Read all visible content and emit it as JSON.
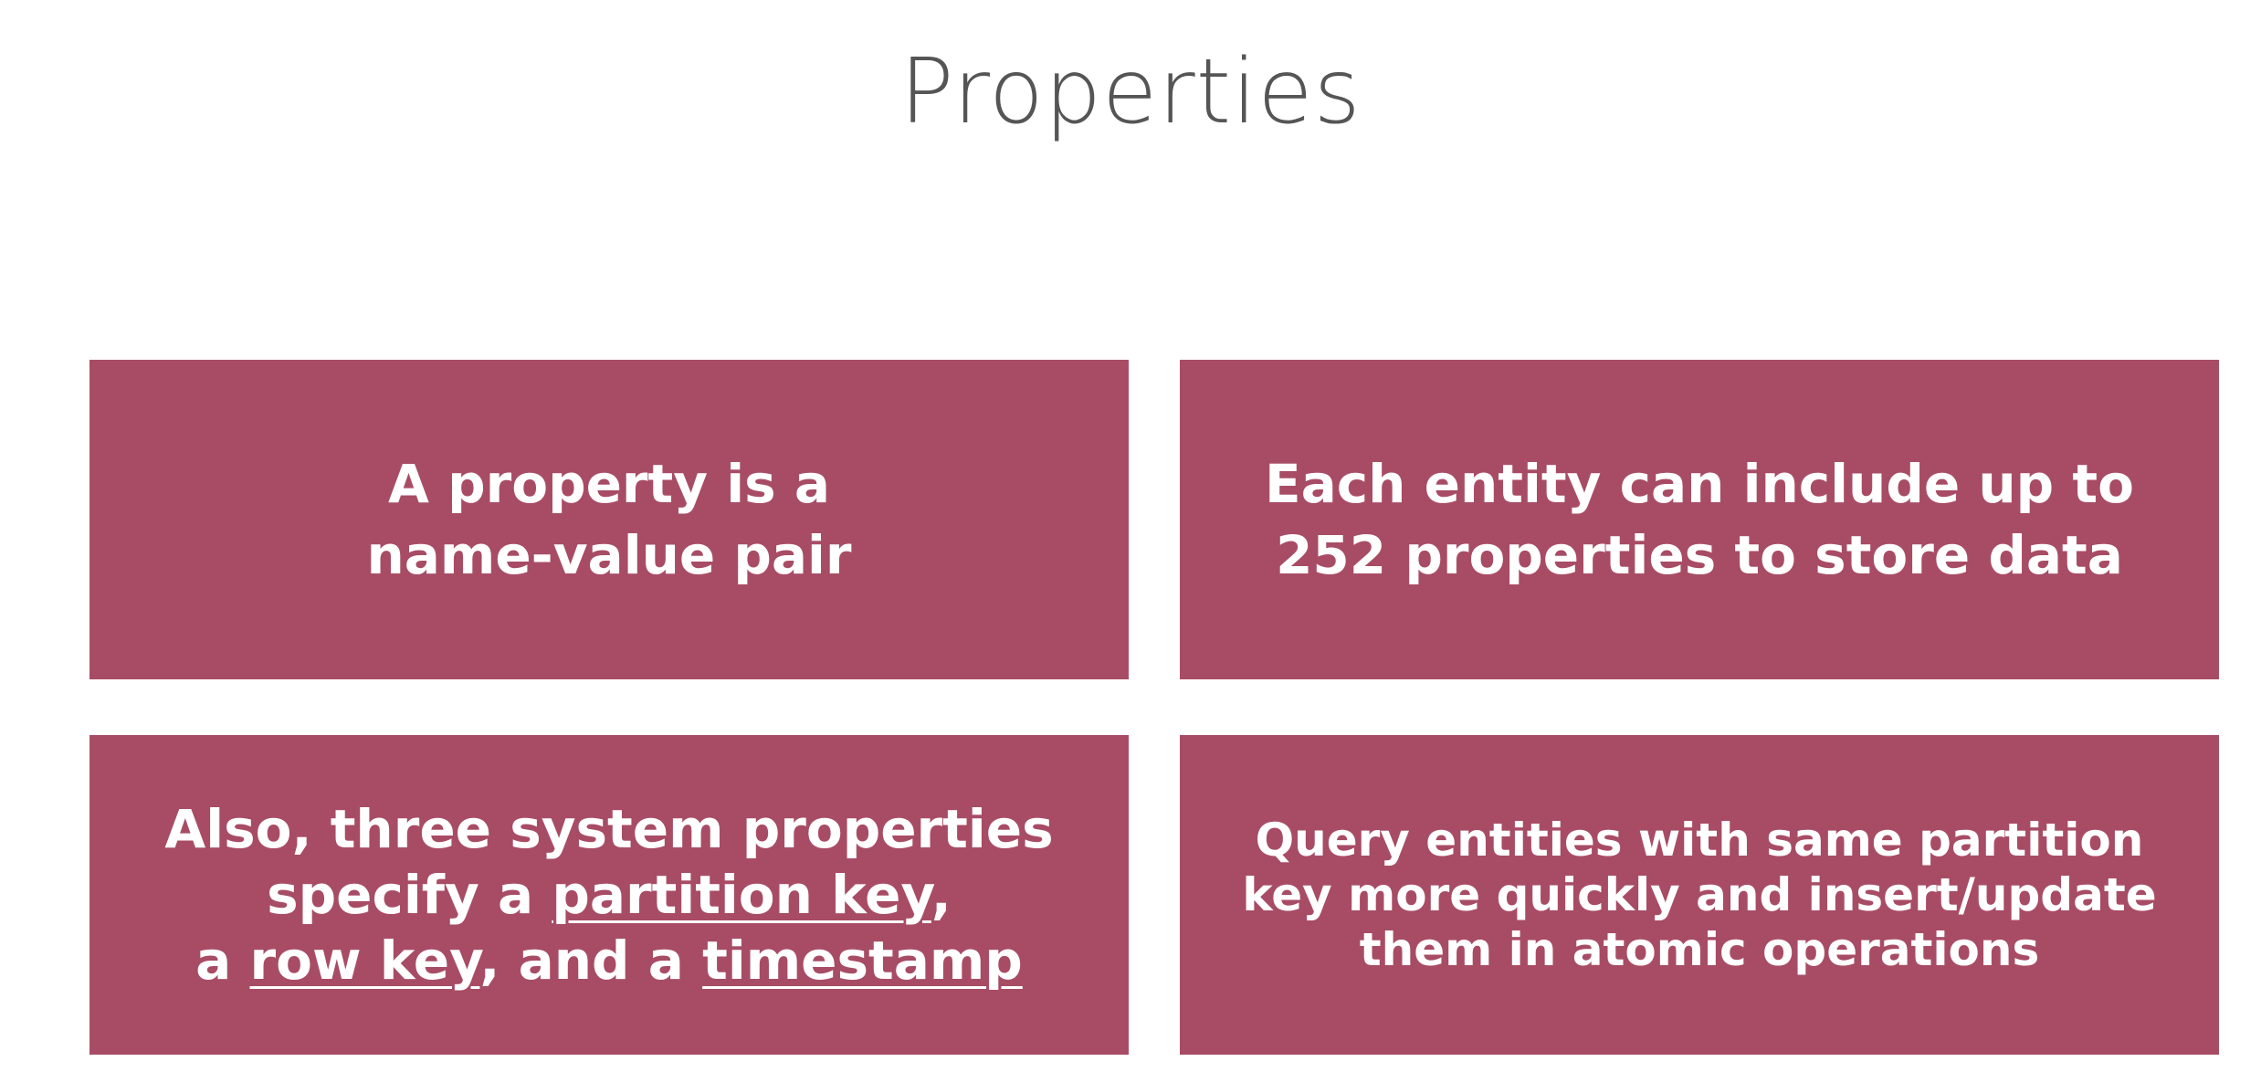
{
  "slide": {
    "title": "Properties"
  },
  "theme": {
    "card_color": "#a84c65",
    "title_color": "#555555",
    "text_color": "#ffffff"
  },
  "cards": [
    {
      "lines": [
        {
          "segments": [
            {
              "text": "A property is a"
            }
          ]
        },
        {
          "segments": [
            {
              "text": "name-value pair"
            }
          ]
        }
      ]
    },
    {
      "lines": [
        {
          "segments": [
            {
              "text": "Each entity can include up to"
            }
          ]
        },
        {
          "segments": [
            {
              "text": "252 properties to store data"
            }
          ]
        }
      ]
    },
    {
      "lines": [
        {
          "segments": [
            {
              "text": "Also, three system properties"
            }
          ]
        },
        {
          "segments": [
            {
              "text": "specify a "
            },
            {
              "text": "partition key",
              "underline": true
            },
            {
              "text": ","
            }
          ]
        },
        {
          "segments": [
            {
              "text": "a "
            },
            {
              "text": "row key",
              "underline": true
            },
            {
              "text": ", and a "
            },
            {
              "text": "timestamp",
              "underline": true
            }
          ]
        }
      ]
    },
    {
      "lines": [
        {
          "segments": [
            {
              "text": "Query entities with same partition"
            }
          ]
        },
        {
          "segments": [
            {
              "text": "key more quickly and insert/update"
            }
          ]
        },
        {
          "segments": [
            {
              "text": "them in atomic operations"
            }
          ]
        }
      ]
    }
  ]
}
